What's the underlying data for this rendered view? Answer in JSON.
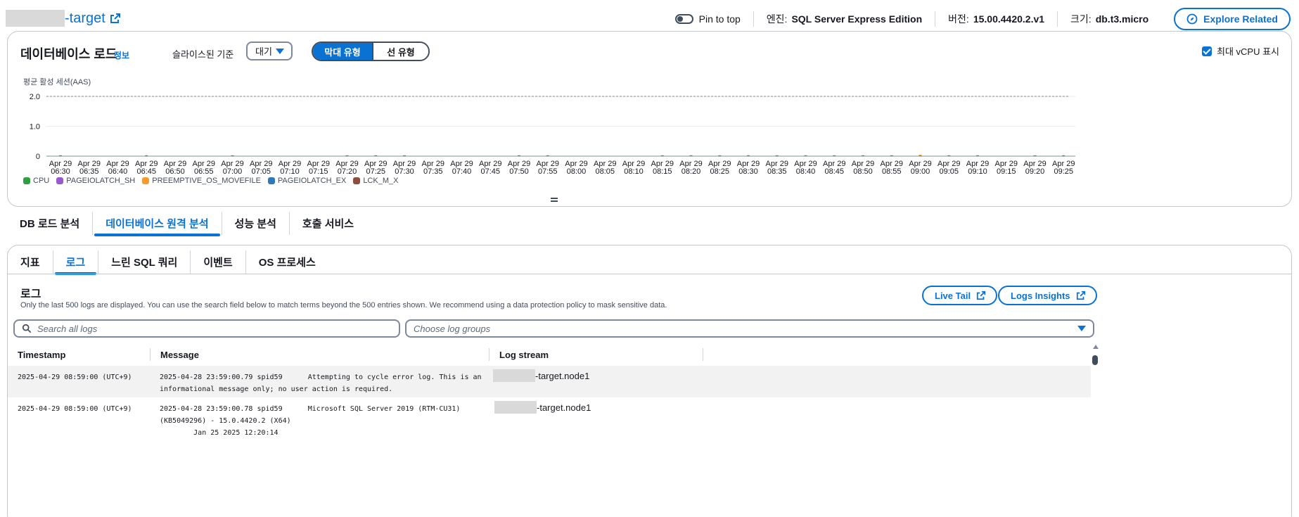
{
  "header": {
    "title_suffix": "-target",
    "pin_label": "Pin to top",
    "engine_label": "엔진:",
    "engine_value": "SQL Server Express Edition",
    "version_label": "버전:",
    "version_value": "15.00.4420.2.v1",
    "size_label": "크기:",
    "size_value": "db.t3.micro",
    "explore_button": "Explore Related"
  },
  "db_load": {
    "title": "데이터베이스 로드",
    "info_link": "정보",
    "sliced_label": "슬라이스된 기준",
    "sliced_value": "대기",
    "segment_bar": "막대 유형",
    "segment_line": "선 유형",
    "max_vcpu_label": "최대 vCPU 표시",
    "max_vcpu_checked": true
  },
  "chart_data": {
    "type": "bar",
    "ylabel": "평균 활성 세션(AAS)",
    "yticks": [
      "2.0",
      "1.0",
      "0"
    ],
    "ylim": [
      0,
      2.0
    ],
    "max_vcpu_line": 2.0,
    "categories": [
      "Apr 29 06:30",
      "Apr 29 06:35",
      "Apr 29 06:40",
      "Apr 29 06:45",
      "Apr 29 06:50",
      "Apr 29 06:55",
      "Apr 29 07:00",
      "Apr 29 07:05",
      "Apr 29 07:10",
      "Apr 29 07:15",
      "Apr 29 07:20",
      "Apr 29 07:25",
      "Apr 29 07:30",
      "Apr 29 07:35",
      "Apr 29 07:40",
      "Apr 29 07:45",
      "Apr 29 07:50",
      "Apr 29 07:55",
      "Apr 29 08:00",
      "Apr 29 08:05",
      "Apr 29 08:10",
      "Apr 29 08:15",
      "Apr 29 08:20",
      "Apr 29 08:25",
      "Apr 29 08:30",
      "Apr 29 08:35",
      "Apr 29 08:40",
      "Apr 29 08:45",
      "Apr 29 08:50",
      "Apr 29 08:55",
      "Apr 29 09:00",
      "Apr 29 09:05",
      "Apr 29 09:10",
      "Apr 29 09:15",
      "Apr 29 09:20",
      "Apr 29 09:25"
    ],
    "tick_line1": [
      "Apr 29",
      "Apr 29",
      "Apr 29",
      "Apr 29",
      "Apr 29",
      "Apr 29",
      "Apr 29",
      "Apr 29",
      "Apr 29",
      "Apr 29",
      "Apr 29",
      "Apr 29",
      "Apr 29",
      "Apr 29",
      "Apr 29",
      "Apr 29",
      "Apr 29",
      "Apr 29",
      "Apr 29",
      "Apr 29",
      "Apr 29",
      "Apr 29",
      "Apr 29",
      "Apr 29",
      "Apr 29",
      "Apr 29",
      "Apr 29",
      "Apr 29",
      "Apr 29",
      "Apr 29",
      "Apr 29",
      "Apr 29",
      "Apr 29",
      "Apr 29",
      "Apr 29",
      "Apr 29"
    ],
    "tick_line2": [
      "06:30",
      "06:35",
      "06:40",
      "06:45",
      "06:50",
      "06:55",
      "07:00",
      "07:05",
      "07:10",
      "07:15",
      "07:20",
      "07:25",
      "07:30",
      "07:35",
      "07:40",
      "07:45",
      "07:50",
      "07:55",
      "08:00",
      "08:05",
      "08:10",
      "08:15",
      "08:20",
      "08:25",
      "08:30",
      "08:35",
      "08:40",
      "08:45",
      "08:50",
      "08:55",
      "09:00",
      "09:05",
      "09:10",
      "09:15",
      "09:20",
      "09:25"
    ],
    "series": [
      {
        "name": "CPU",
        "color": "#2ea043",
        "values": [
          0.01,
          0,
          0,
          0.01,
          0,
          0,
          0.01,
          0,
          0,
          0,
          0.01,
          0.01,
          0.01,
          0,
          0,
          0,
          0.01,
          0.01,
          0,
          0,
          0,
          0.01,
          0.01,
          0.01,
          0.01,
          0.01,
          0.01,
          0.01,
          0.01,
          0.01,
          0.01,
          0.01,
          0.01,
          0,
          0.01,
          0.01
        ]
      },
      {
        "name": "PAGEIOLATCH_SH",
        "color": "#9b59d0",
        "values": [
          0,
          0,
          0,
          0,
          0,
          0,
          0,
          0,
          0,
          0,
          0,
          0,
          0,
          0,
          0,
          0,
          0,
          0,
          0,
          0,
          0,
          0,
          0,
          0,
          0,
          0,
          0,
          0,
          0,
          0,
          0.01,
          0,
          0,
          0,
          0,
          0
        ]
      },
      {
        "name": "PREEMPTIVE_OS_MOVEFILE",
        "color": "#f89c30",
        "values": [
          0,
          0,
          0,
          0,
          0,
          0,
          0,
          0,
          0,
          0,
          0,
          0,
          0,
          0,
          0,
          0,
          0,
          0,
          0,
          0,
          0,
          0,
          0,
          0,
          0,
          0,
          0,
          0,
          0,
          0,
          0.01,
          0,
          0,
          0,
          0,
          0
        ]
      },
      {
        "name": "PAGEIOLATCH_EX",
        "color": "#2d7ab8",
        "values": [
          0,
          0,
          0,
          0,
          0,
          0,
          0,
          0,
          0,
          0,
          0,
          0,
          0,
          0,
          0,
          0,
          0,
          0,
          0,
          0,
          0,
          0,
          0,
          0,
          0,
          0,
          0,
          0,
          0,
          0,
          0,
          0,
          0,
          0,
          0,
          0
        ]
      },
      {
        "name": "LCK_M_X",
        "color": "#8f4d3f",
        "values": [
          0,
          0,
          0,
          0,
          0,
          0,
          0,
          0,
          0,
          0,
          0,
          0,
          0,
          0,
          0,
          0,
          0,
          0,
          0,
          0,
          0,
          0,
          0,
          0,
          0,
          0,
          0,
          0,
          0,
          0,
          0,
          0,
          0,
          0,
          0,
          0
        ]
      }
    ]
  },
  "main_tabs": [
    {
      "label": "DB 로드 분석"
    },
    {
      "label": "데이터베이스 원격 분석"
    },
    {
      "label": "성능 분석"
    },
    {
      "label": "호출 서비스"
    }
  ],
  "sub_tabs": [
    {
      "label": "지표"
    },
    {
      "label": "로그"
    },
    {
      "label": "느린 SQL 쿼리"
    },
    {
      "label": "이벤트"
    },
    {
      "label": "OS 프로세스"
    }
  ],
  "logs": {
    "title": "로그",
    "description": "Only the last 500 logs are displayed. You can use the search field below to match terms beyond the 500 entries shown. We recommend using a data protection policy to mask sensitive data.",
    "live_tail": "Live Tail",
    "insights": "Logs Insights",
    "search_placeholder": "Search all logs",
    "groups_placeholder": "Choose log groups",
    "columns": {
      "timestamp": "Timestamp",
      "message": "Message",
      "stream": "Log stream"
    },
    "rows": [
      {
        "timestamp": "2025-04-29 08:59:00 (UTC+9)",
        "message": "2025-04-28 23:59:00.79 spid59      Attempting to cycle error log. This is an\ninformational message only; no user action is required.",
        "stream_suffix": "-target.node1"
      },
      {
        "timestamp": "2025-04-29 08:59:00 (UTC+9)",
        "message": "2025-04-28 23:59:00.78 spid59      Microsoft SQL Server 2019 (RTM-CU31)\n(KB5049296) - 15.0.4420.2 (X64)\n        Jan 25 2025 12:20:14",
        "stream_suffix": "-target.node1"
      }
    ]
  }
}
